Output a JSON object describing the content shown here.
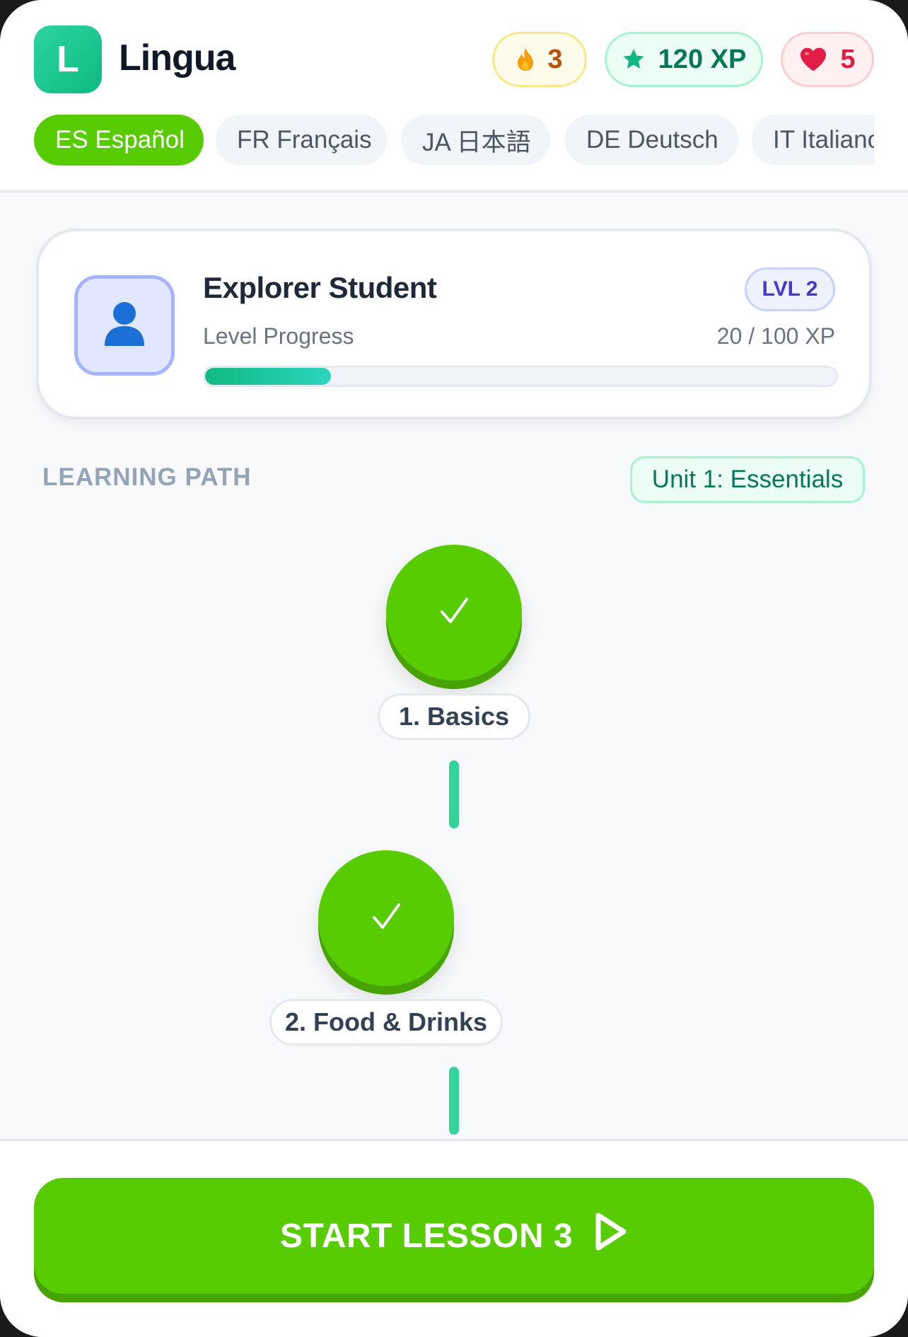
{
  "app": {
    "logo_letter": "L",
    "title": "Lingua"
  },
  "stats": {
    "streak": "3",
    "xp": "120 XP",
    "hearts": "5"
  },
  "languages": [
    {
      "label": "ES Español",
      "active": true
    },
    {
      "label": "FR Français",
      "active": false
    },
    {
      "label": "JA 日本語",
      "active": false
    },
    {
      "label": "DE Deutsch",
      "active": false
    },
    {
      "label": "IT Italiano",
      "active": false
    }
  ],
  "profile": {
    "name": "Explorer Student",
    "level_badge": "LVL 2",
    "progress_label": "Level Progress",
    "progress_text": "20 / 100 XP",
    "progress_fraction": 0.2
  },
  "path": {
    "section_title": "LEARNING PATH",
    "unit": "Unit 1: Essentials",
    "lessons": [
      {
        "label": "1. Basics",
        "status": "completed"
      },
      {
        "label": "2. Food & Drinks",
        "status": "completed"
      }
    ]
  },
  "cta": {
    "label": "START LESSON 3"
  },
  "icons": {
    "streak": "flame-icon",
    "xp": "star-icon",
    "hearts": "heart-icon",
    "avatar": "user-icon",
    "completed": "checkmark-icon",
    "cta": "play-icon"
  },
  "colors": {
    "primary": "#58cc02",
    "accent": "#10b981",
    "streak": "#f59e0b",
    "hearts": "#e11d48"
  }
}
